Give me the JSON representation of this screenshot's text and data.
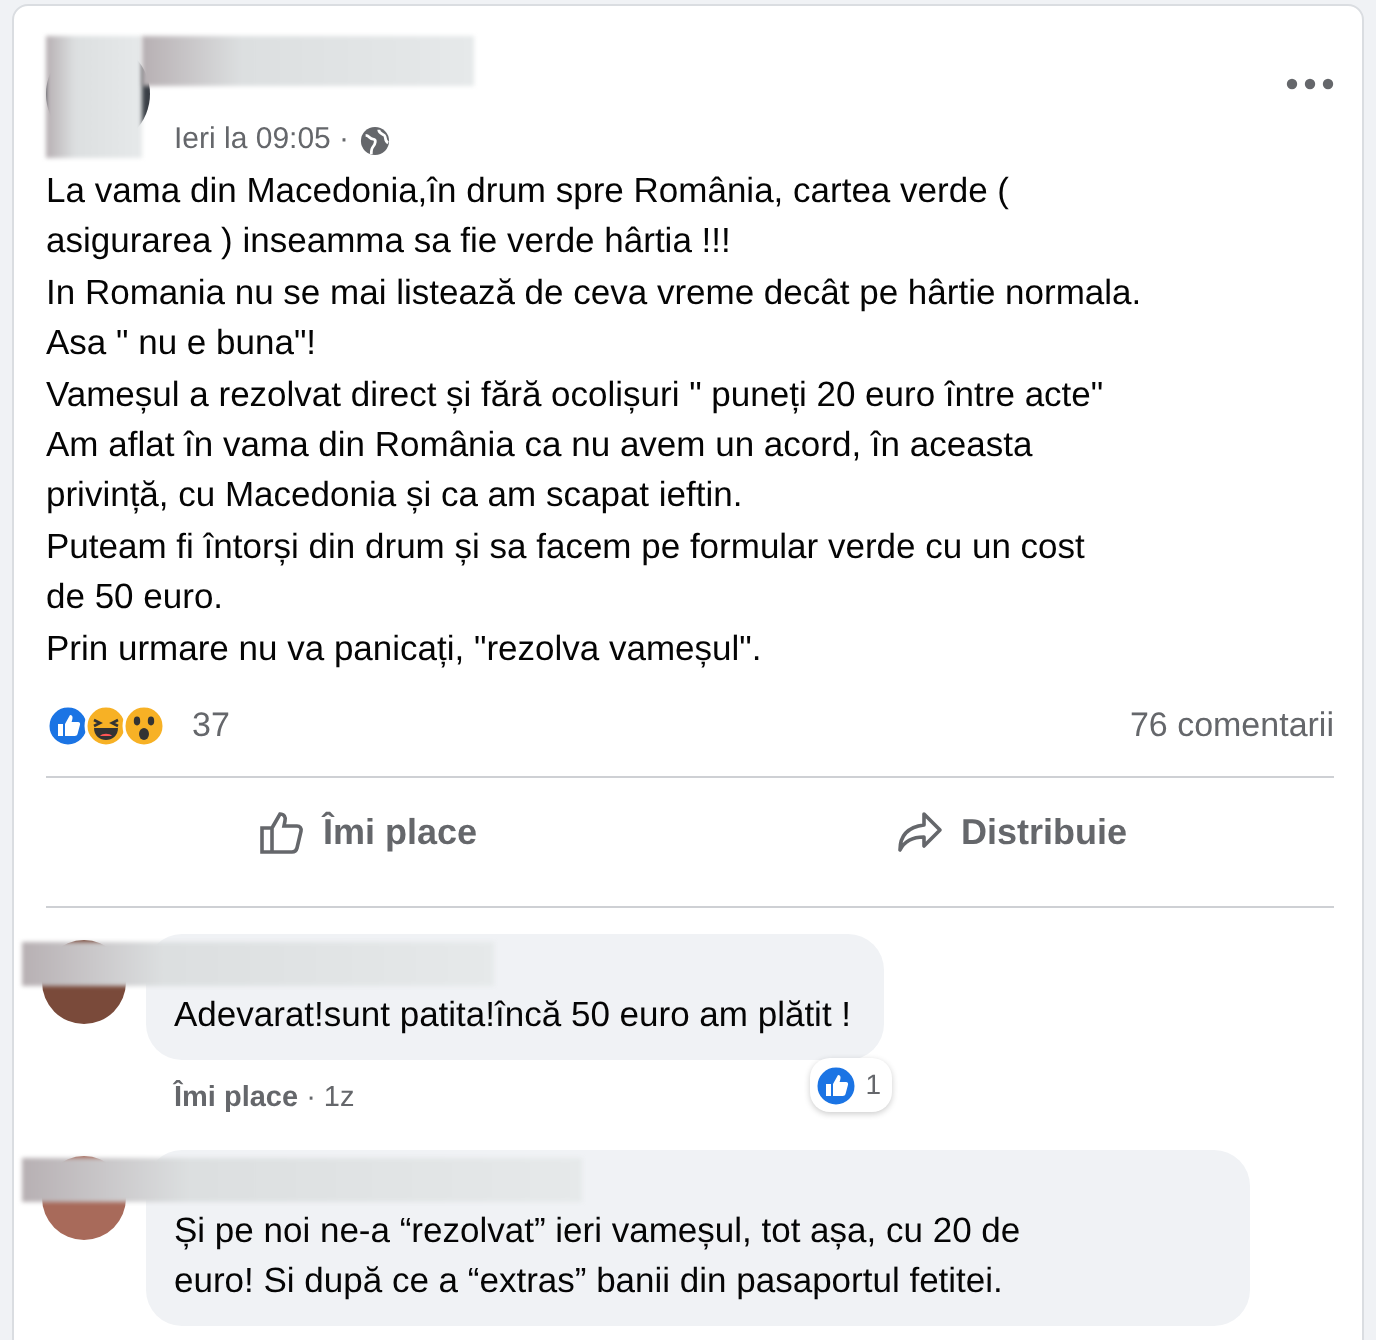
{
  "post": {
    "time": "Ieri la 09:05 ·",
    "lines": [
      "La vama din Macedonia,în drum spre România, cartea verde (",
      "asigurarea ) inseamma sa fie verde hârtia !!!",
      "In Romania nu se mai listează de ceva vreme decât pe hârtie normala.",
      "Asa  \" nu e buna\"!",
      "Vameșul a rezolvat direct și fără ocolișuri \" puneți 20 euro între acte\"",
      "Am aflat în vama din România ca nu avem un acord, în aceasta",
      "privință, cu Macedonia și ca am scapat ieftin.",
      "Puteam fi întorși din drum și sa facem pe formular  verde cu un cost",
      "de 50  euro.",
      "Prin urmare nu va panicați, \"rezolva vameșul\"."
    ],
    "reaction_count": "37",
    "comments_count": "76 comentarii",
    "actions": [
      {
        "kind": "like",
        "label": "Îmi place"
      },
      {
        "kind": "share",
        "label": "Distribuie"
      }
    ]
  },
  "comments": [
    {
      "lines": [
        "Adevarat!sunt patita!încă 50 euro am plătit !"
      ],
      "like_label": "Îmi place",
      "age": "· 1z",
      "reaction_count": "1"
    },
    {
      "lines": [
        "Și pe noi ne-a “rezolvat” ieri vameșul, tot așa, cu 20 de",
        "euro! Si după ce a “extras” banii din pasaportul fetitei."
      ]
    }
  ]
}
